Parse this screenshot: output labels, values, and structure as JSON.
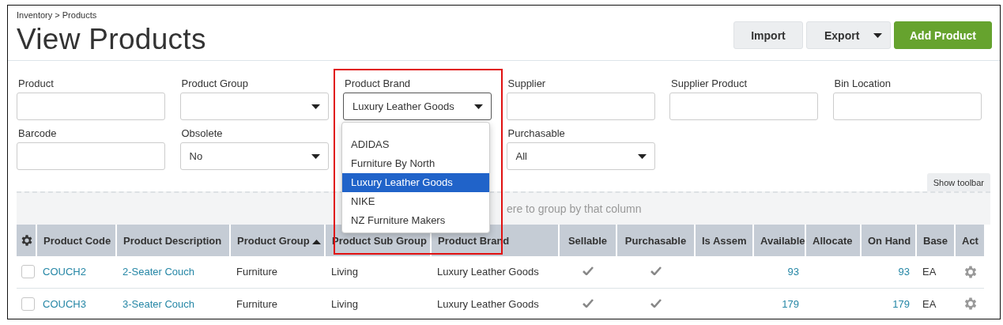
{
  "breadcrumb": "Inventory > Products",
  "title": "View Products",
  "actions": [
    {
      "label": "Import",
      "kind": "plain"
    },
    {
      "label": "Export",
      "kind": "split"
    },
    {
      "label": "Add Product",
      "kind": "primary"
    }
  ],
  "filters": [
    {
      "label": "Product",
      "kind": "text"
    },
    {
      "label": "Product Group",
      "kind": "select"
    },
    {
      "label": "Product Brand",
      "kind": "select",
      "value": "Luxury Leather Goods",
      "highlighted": true,
      "expanded": true,
      "options": [
        {
          "label": "ADIDAS",
          "selected": false
        },
        {
          "label": "Furniture By North",
          "selected": false
        },
        {
          "label": "Luxury Leather Goods",
          "selected": true
        },
        {
          "label": "NIKE",
          "selected": false
        },
        {
          "label": "NZ Furniture Makers",
          "selected": false
        }
      ]
    },
    {
      "label": "Supplier",
      "kind": "text"
    },
    {
      "label": "Supplier Product",
      "kind": "text"
    },
    {
      "label": "Bin Location",
      "kind": "text"
    },
    {
      "label": "Barcode",
      "kind": "text"
    },
    {
      "label": "Obsolete",
      "kind": "select",
      "value": "No"
    },
    {
      "kind": "hidden"
    },
    {
      "label": "Purchasable",
      "kind": "select",
      "value": "All"
    }
  ],
  "toolbar_toggle": "Show toolbar",
  "group_hint": "ere to group by that column",
  "table": {
    "columns": [
      {
        "label": "Product Code"
      },
      {
        "label": "Product Description"
      },
      {
        "label": "Product Group",
        "sorted_ascending": true
      },
      {
        "label": "Product Sub Group"
      },
      {
        "label": "Product Brand"
      },
      {
        "label": "Sellable"
      },
      {
        "label": "Purchasable"
      },
      {
        "label": "Is Assem"
      },
      {
        "label": "Available"
      },
      {
        "label": "Allocate"
      },
      {
        "label": "On Hand"
      },
      {
        "label": "Base"
      },
      {
        "label": "Act"
      }
    ],
    "rows": [
      {
        "checked": false,
        "code": "COUCH2",
        "description": "2-Seater Couch",
        "group": "Furniture",
        "sub_group": "Living",
        "brand": "Luxury Leather Goods",
        "sellable": true,
        "purchasable": true,
        "available": "93",
        "on_hand": "93",
        "base": "EA"
      },
      {
        "checked": false,
        "code": "COUCH3",
        "description": "3-Seater Couch",
        "group": "Furniture",
        "sub_group": "Living",
        "brand": "Luxury Leather Goods",
        "sellable": true,
        "purchasable": true,
        "available": "179",
        "on_hand": "179",
        "base": "EA"
      }
    ]
  }
}
